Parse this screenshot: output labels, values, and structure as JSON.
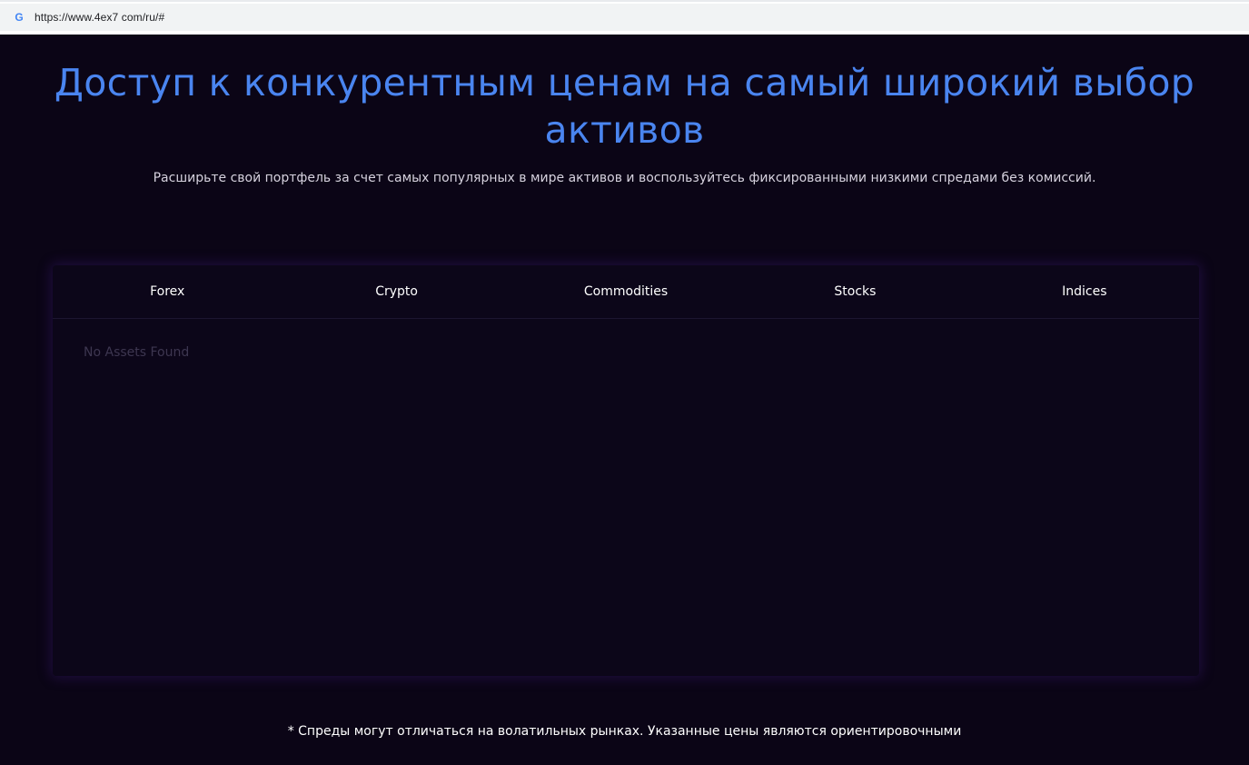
{
  "browser": {
    "favicon_icon": "google-g-icon",
    "favicon_glyph": "G",
    "url": "https://www.4ex7 com/ru/#"
  },
  "hero": {
    "title": "Доступ к конкурентным ценам на самый широкий выбор активов",
    "subtitle": "Расширьте свой портфель за счет самых популярных в мире активов и воспользуйтесь фиксированными низкими спредами без комиссий."
  },
  "assets_panel": {
    "tabs": [
      {
        "label": "Forex"
      },
      {
        "label": "Crypto"
      },
      {
        "label": "Commodities"
      },
      {
        "label": "Stocks"
      },
      {
        "label": "Indices"
      }
    ],
    "empty_message": "No Assets Found"
  },
  "footnote": "* Спреды могут отличаться на волатильных рынках. Указанные цены являются ориентировочными",
  "colors": {
    "background": "#0b0516",
    "headline": "#4a85f0",
    "panel": "#0c0619",
    "text": "#ffffff",
    "muted": "#3d3650"
  }
}
